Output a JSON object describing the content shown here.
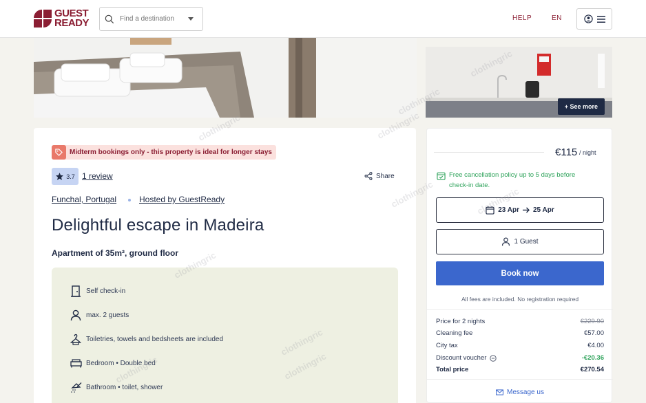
{
  "header": {
    "logo_line1": "GUEST",
    "logo_line2": "READY",
    "search_placeholder": "Find a destination",
    "help_label": "HELP",
    "lang_label": "EN"
  },
  "gallery": {
    "see_more_label": "+ See more"
  },
  "listing": {
    "promo_text": "Midterm bookings only - this property is ideal for longer stays",
    "rating": "3.7",
    "reviews_label": "1 review",
    "share_label": "Share",
    "location": "Funchal, Portugal",
    "host": "Hosted by GuestReady",
    "title": "Delightful escape in Madeira",
    "subtitle": "Apartment of 35m², ground floor",
    "features": [
      {
        "icon": "door-icon",
        "text": "Self check-in"
      },
      {
        "icon": "person-icon",
        "text": "max. 2 guests"
      },
      {
        "icon": "hanger-icon",
        "text": "Toiletries, towels and bedsheets are included"
      },
      {
        "icon": "bed-icon",
        "text": "Bedroom • Double bed"
      },
      {
        "icon": "shower-icon",
        "text": "Bathroom • toilet, shower"
      }
    ]
  },
  "booking": {
    "price": "€115",
    "per_night": "/ night",
    "free_cancel_line1": "Free cancellation policy up to 5 days before",
    "free_cancel_line2": "check-in date.",
    "date_from": "23 Apr",
    "date_to": "25 Apr",
    "guests": "1 Guest",
    "book_label": "Book now",
    "fees_note": "All fees are included. No registration required",
    "lines": [
      {
        "label": "Price for 2 nights",
        "value": "€229.90"
      },
      {
        "label": "Cleaning fee",
        "value": "€57.00"
      },
      {
        "label": "City tax",
        "value": "€4.00"
      },
      {
        "label": "Discount voucher",
        "value": "-€20.36"
      },
      {
        "label": "Total price",
        "value": "€270.54"
      }
    ],
    "message_label": "Message us"
  },
  "watermark": "clothingric",
  "colors": {
    "brand": "#8b1e33",
    "primary_button": "#3b67cd",
    "success": "#2fa35b",
    "navy": "#1f2a44"
  }
}
